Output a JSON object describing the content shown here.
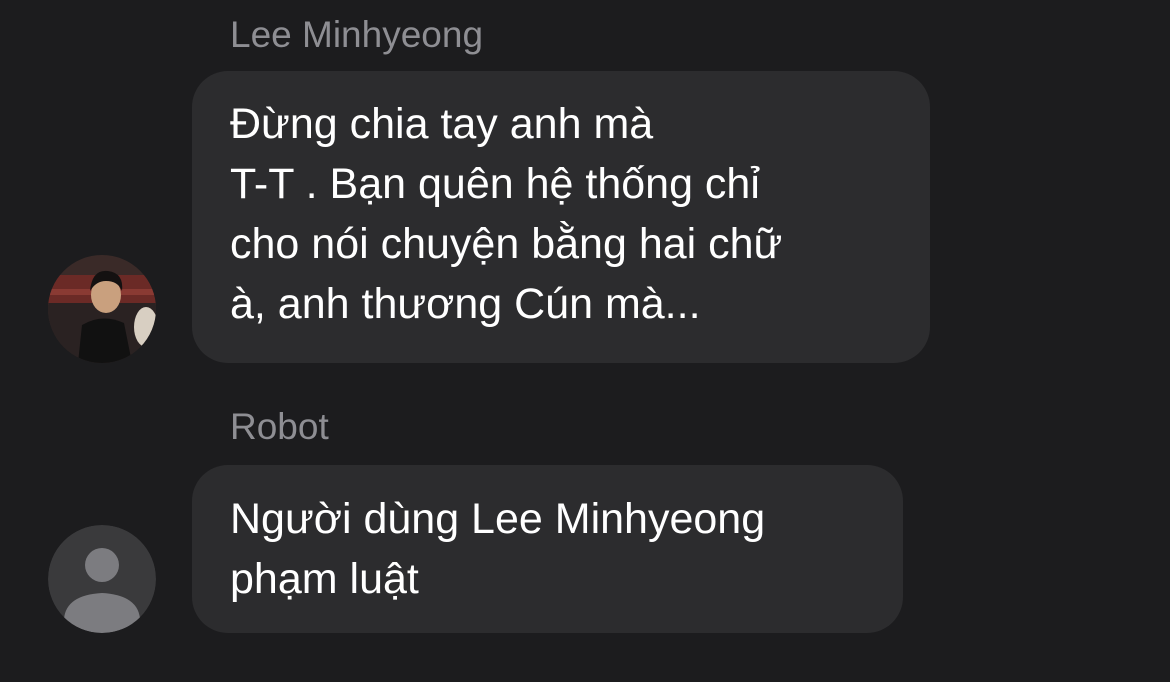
{
  "messages": [
    {
      "sender": "Lee Minhyeong",
      "avatar": "photo-avatar",
      "lines": [
        "Đừng chia tay anh mà",
        "T-T . Bạn quên hệ thống chỉ",
        "cho nói chuyện bằng hai chữ",
        "à, anh thương Cún mà..."
      ]
    },
    {
      "sender": "Robot",
      "avatar": "default-user-icon",
      "lines": [
        "Người dùng Lee Minhyeong",
        "phạm luật"
      ]
    }
  ],
  "colors": {
    "background": "#1c1c1e",
    "bubble": "#2c2c2e",
    "sender_name": "#8e8e93",
    "message_text": "#ffffff",
    "default_avatar_bg": "#3a3a3c",
    "default_avatar_glyph": "#7c7c80"
  }
}
